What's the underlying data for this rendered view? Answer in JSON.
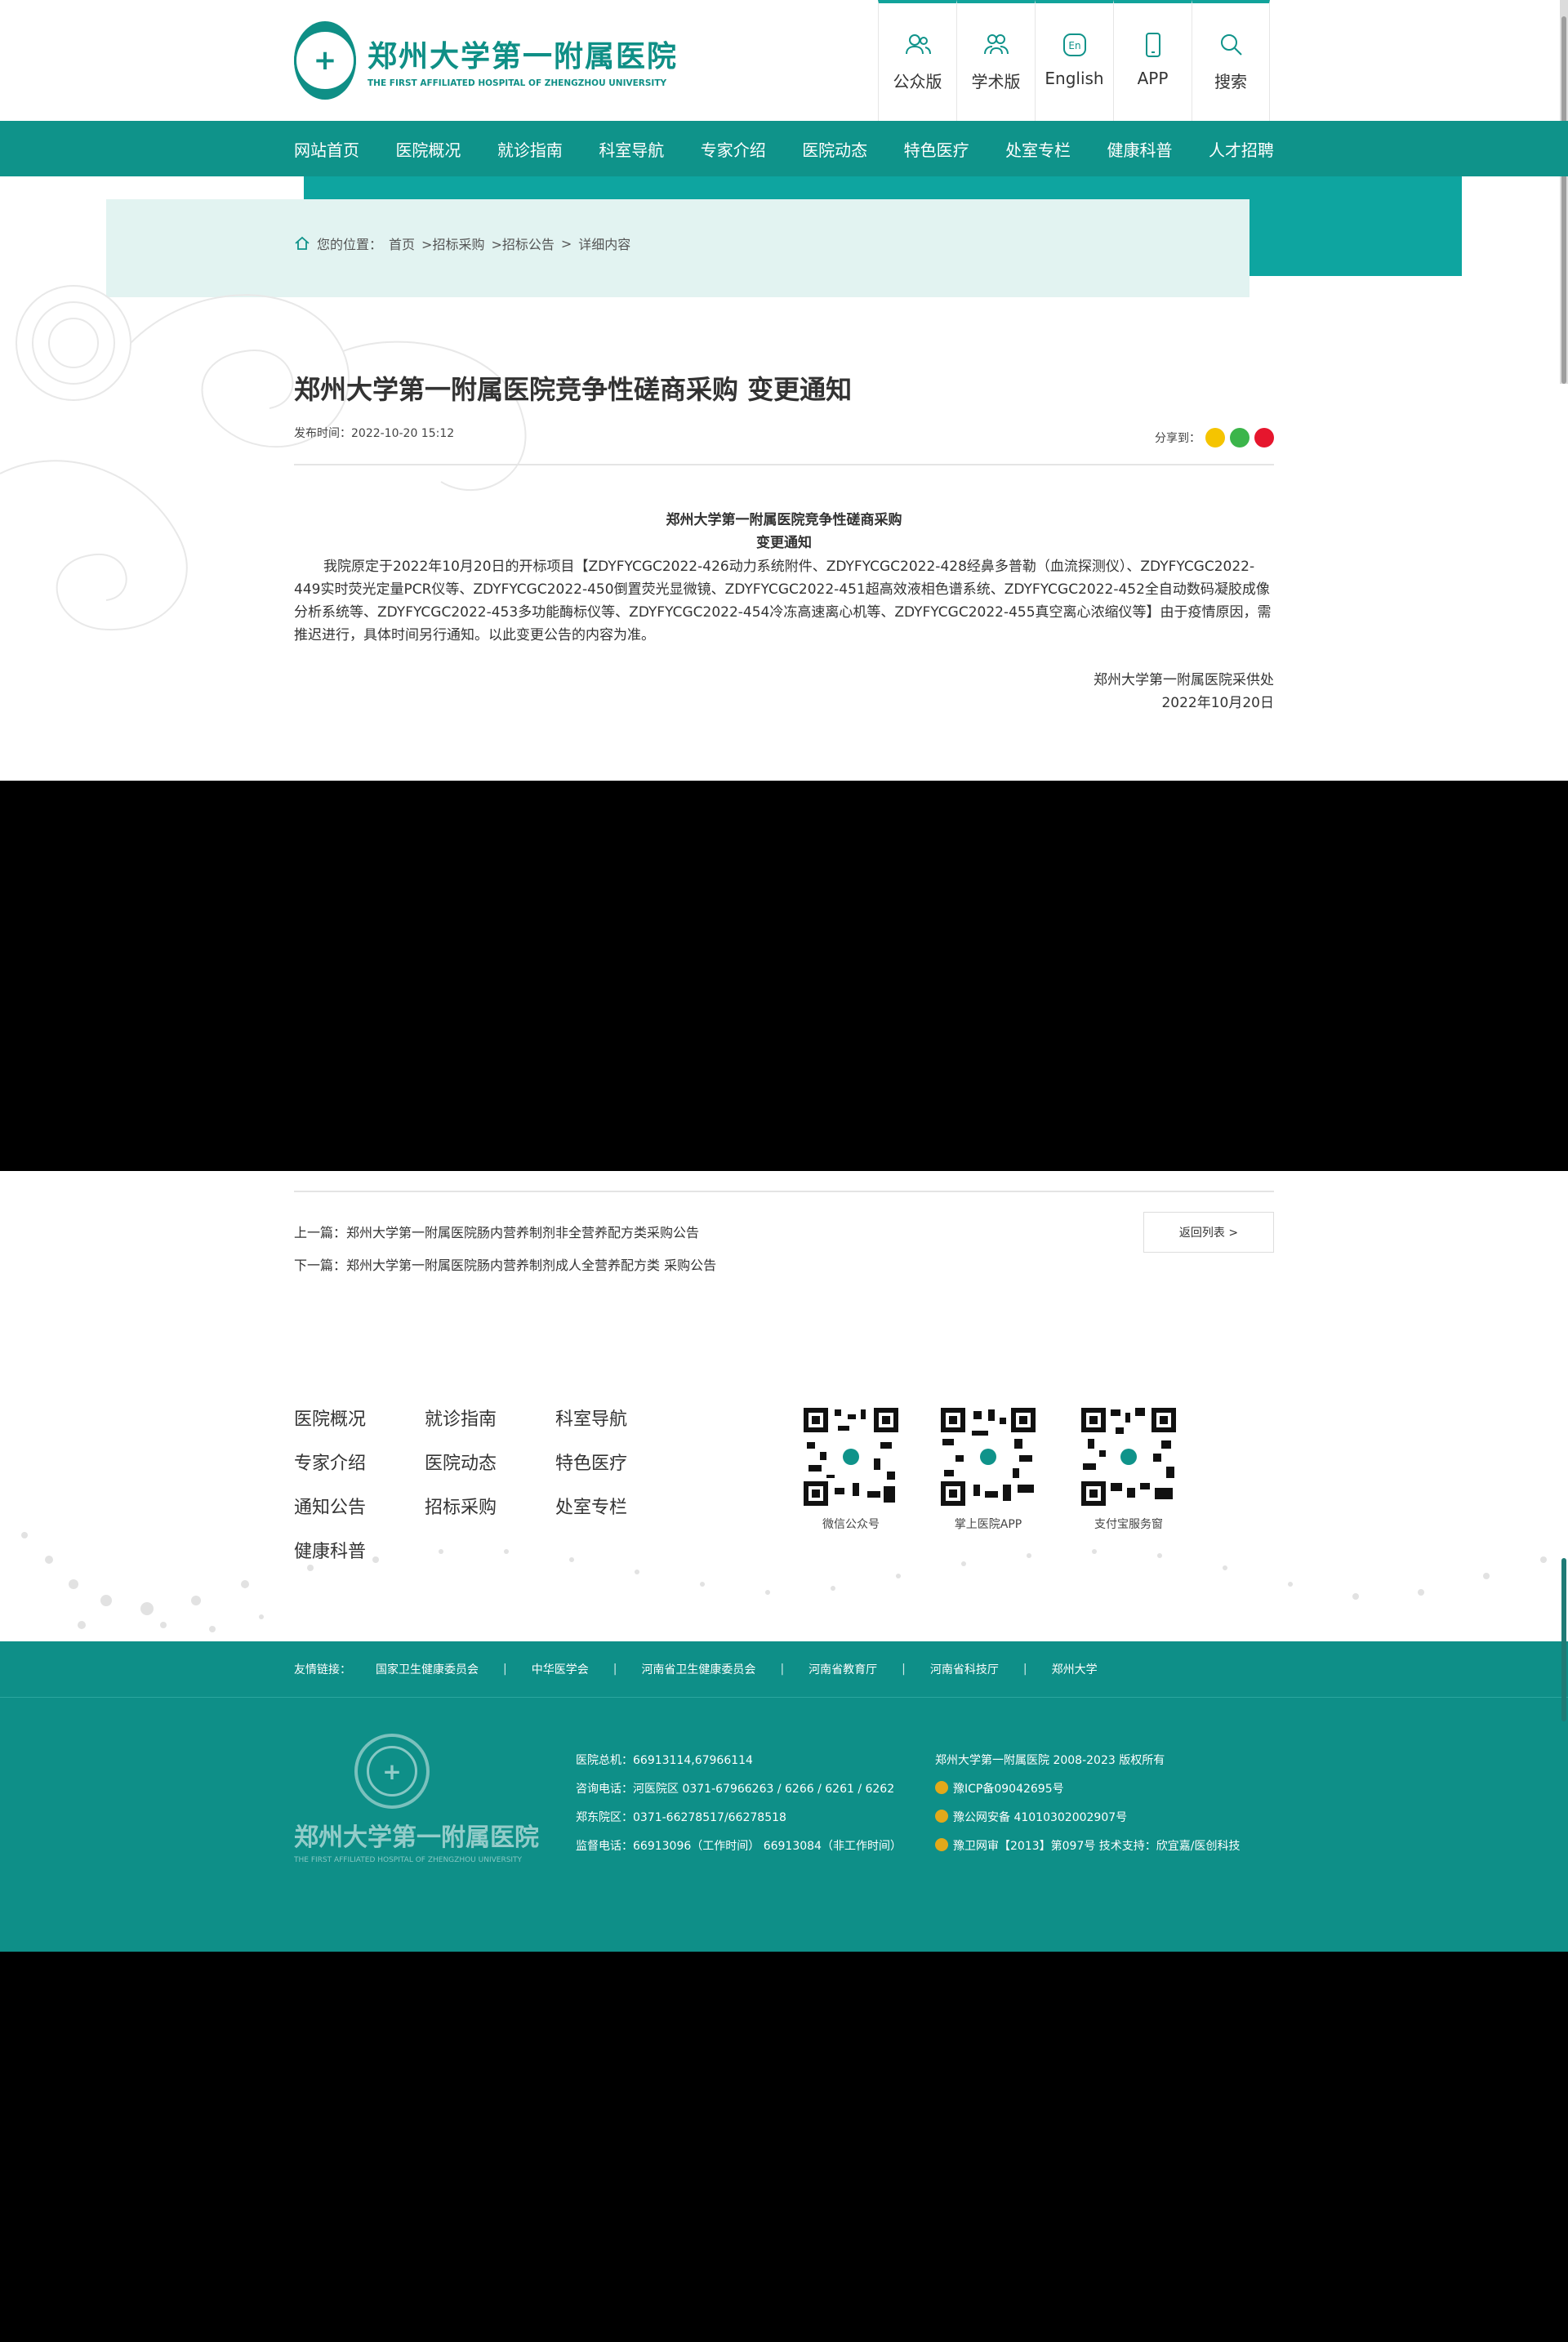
{
  "header": {
    "logo_cn": "郑州大学第一附属医院",
    "logo_en": "THE FIRST AFFILIATED HOSPITAL OF ZHENGZHOU UNIVERSITY",
    "tools": [
      {
        "label": "公众版",
        "icon": "users-icon"
      },
      {
        "label": "学术版",
        "icon": "academic-icon"
      },
      {
        "label": "English",
        "icon": "english-icon"
      },
      {
        "label": "APP",
        "icon": "phone-icon"
      },
      {
        "label": "搜索",
        "icon": "search-icon"
      }
    ],
    "accent": "#0f938a"
  },
  "nav": {
    "items": [
      "网站首页",
      "医院概况",
      "就诊指南",
      "科室导航",
      "专家介绍",
      "医院动态",
      "特色医疗",
      "处室专栏",
      "健康科普",
      "人才招聘"
    ]
  },
  "breadcrumb": {
    "prefix": "您的位置：",
    "items": [
      "首页",
      ">招标采购",
      ">招标公告",
      ">",
      "详细内容"
    ]
  },
  "article": {
    "title": "郑州大学第一附属医院竞争性磋商采购 变更通知",
    "publish_time": "发布时间：2022-10-20 15:12",
    "share_label": "分享到：",
    "content_title_1": "郑州大学第一附属医院竞争性磋商采购",
    "content_title_2": "变更通知",
    "body": "我院原定于2022年10月20日的开标项目【ZDYFYCGC2022-426动力系统附件、ZDYFYCGC2022-428经鼻多普勒（血流探测仪）、ZDYFYCGC2022-449实时荧光定量PCR仪等、ZDYFYCGC2022-450倒置荧光显微镜、ZDYFYCGC2022-451超高效液相色谱系统、ZDYFYCGC2022-452全自动数码凝胶成像分析系统等、ZDYFYCGC2022-453多功能酶标仪等、ZDYFYCGC2022-454冷冻高速离心机等、ZDYFYCGC2022-455真空离心浓缩仪等】由于疫情原因，需推迟进行，具体时间另行通知。以此变更公告的内容为准。",
    "sign_org": "郑州大学第一附属医院采供处",
    "sign_date": "2022年10月20日"
  },
  "pager": {
    "prev_label": "上一篇：",
    "prev_title": "郑州大学第一附属医院肠内营养制剂非全营养配方类采购公告",
    "next_label": "下一篇：",
    "next_title": "郑州大学第一附属医院肠内营养制剂成人全营养配方类 采购公告",
    "back_label": "返回列表 >"
  },
  "footer_links": [
    "医院概况",
    "就诊指南",
    "科室导航",
    "专家介绍",
    "医院动态",
    "特色医疗",
    "通知公告",
    "招标采购",
    "处室专栏",
    "健康科普"
  ],
  "qr_codes": [
    "微信公众号",
    "掌上医院APP",
    "支付宝服务窗"
  ],
  "friends": {
    "label": "友情链接：",
    "items": [
      "国家卫生健康委员会",
      "中华医学会",
      "河南省卫生健康委员会",
      "河南省教育厅",
      "河南省科技厅",
      "郑州大学"
    ]
  },
  "footer": {
    "logo_cn": "郑州大学第一附属医院",
    "logo_en": "THE FIRST AFFILIATED HOSPITAL OF ZHENGZHOU UNIVERSITY",
    "contact": [
      "医院总机：66913114,67966114",
      "咨询电话：河医院区 0371-67966263 / 6266 / 6261 / 6262",
      "郑东院区：0371-66278517/66278518",
      "监督电话：66913096（工作时间） 66913084（非工作时间）"
    ],
    "copyright": "郑州大学第一附属医院 2008-2023 版权所有",
    "icp": "豫ICP备09042695号",
    "police": "豫公网安备 41010302002907号",
    "health": "豫卫网审【2013】第097号   技术支持：欣宜嘉/医创科技"
  }
}
